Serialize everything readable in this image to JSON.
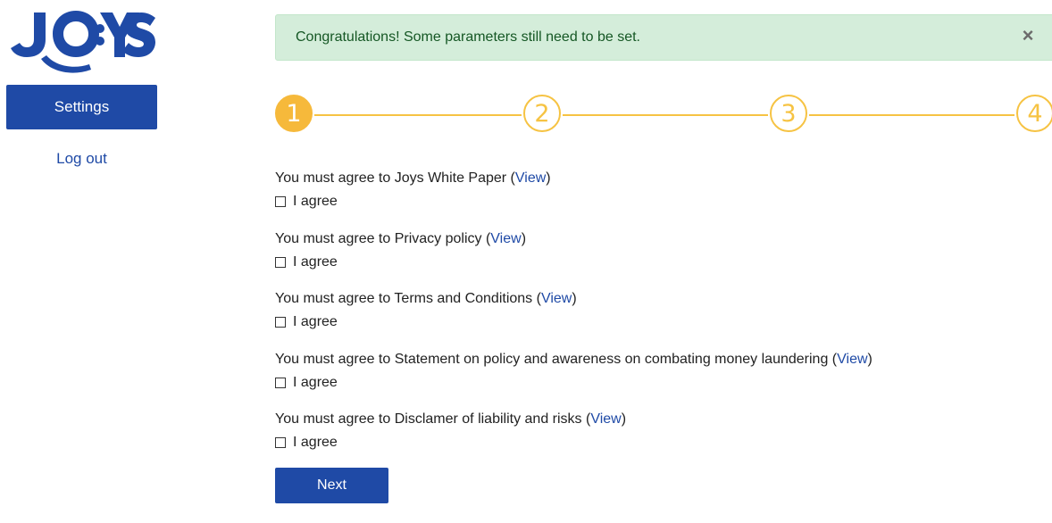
{
  "brand": {
    "logo_text": "JOYS",
    "color": "#1f4aa6"
  },
  "sidebar": {
    "settings_label": "Settings",
    "logout_label": "Log out"
  },
  "alert": {
    "message": "Congratulations! Some parameters still need to be set.",
    "close_icon": "×"
  },
  "stepper": {
    "active_color": "#f6b93b",
    "steps": [
      {
        "label": "1",
        "state": "active"
      },
      {
        "label": "2",
        "state": "pending"
      },
      {
        "label": "3",
        "state": "pending"
      },
      {
        "label": "4",
        "state": "pending"
      }
    ]
  },
  "agreements": [
    {
      "prefix": "You must agree to Joys White Paper (",
      "link": "View",
      "suffix": ")",
      "checkbox_label": "I agree"
    },
    {
      "prefix": "You must agree to Privacy policy (",
      "link": "View",
      "suffix": ")",
      "checkbox_label": "I agree"
    },
    {
      "prefix": "You must agree to Terms and Conditions (",
      "link": "View",
      "suffix": ")",
      "checkbox_label": "I agree"
    },
    {
      "prefix": "You must agree to Statement on policy and awareness on combating money laundering (",
      "link": "View",
      "suffix": ")",
      "checkbox_label": "I agree"
    },
    {
      "prefix": "You must agree to Disclamer of liability and risks (",
      "link": "View",
      "suffix": ")",
      "checkbox_label": "I agree"
    }
  ],
  "next_label": "Next"
}
